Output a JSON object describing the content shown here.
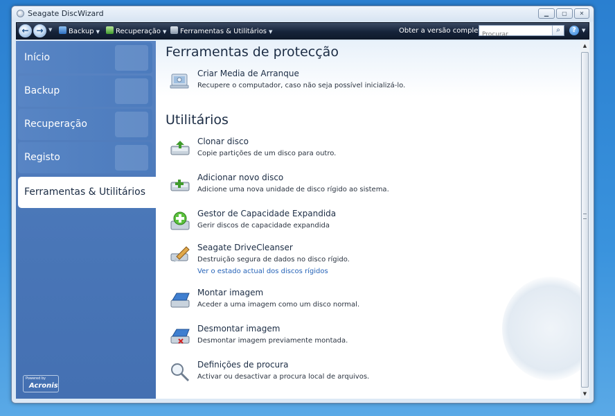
{
  "window": {
    "title": "Seagate DiscWizard"
  },
  "toolbar": {
    "backup_label": "Backup",
    "recovery_label": "Recuperação",
    "tools_label": "Ferramentas & Utilitários",
    "upgrade_label": "Obter a versão completa",
    "search_placeholder": "Procurar"
  },
  "sidebar": {
    "items": [
      {
        "label": "Início"
      },
      {
        "label": "Backup"
      },
      {
        "label": "Recuperação"
      },
      {
        "label": "Registo"
      },
      {
        "label": "Ferramentas & Utilitários"
      }
    ],
    "powered_by": "Powered by",
    "brand": "Acronis"
  },
  "content": {
    "protection_title": "Ferramentas de protecção",
    "protection_tools": [
      {
        "name": "Criar Media de Arranque",
        "desc": "Recupere o computador, caso não seja possível inicializá-lo."
      }
    ],
    "utilities_title": "Utilitários",
    "utilities": [
      {
        "name": "Clonar disco",
        "desc": "Copie partições de um disco para outro."
      },
      {
        "name": "Adicionar novo disco",
        "desc": "Adicione uma nova unidade de disco rígido ao sistema."
      },
      {
        "name": "Gestor de Capacidade Expandida",
        "desc": "Gerir discos de capacidade expandida"
      },
      {
        "name": "Seagate DriveCleanser",
        "desc": "Destruição segura de dados no disco rígido.",
        "link": "Ver o estado actual dos discos rígidos"
      },
      {
        "name": "Montar imagem",
        "desc": "Aceder a uma imagem como um disco normal."
      },
      {
        "name": "Desmontar imagem",
        "desc": "Desmontar imagem previamente montada."
      },
      {
        "name": "Definições de procura",
        "desc": "Activar ou desactivar a procura local de arquivos."
      }
    ]
  }
}
